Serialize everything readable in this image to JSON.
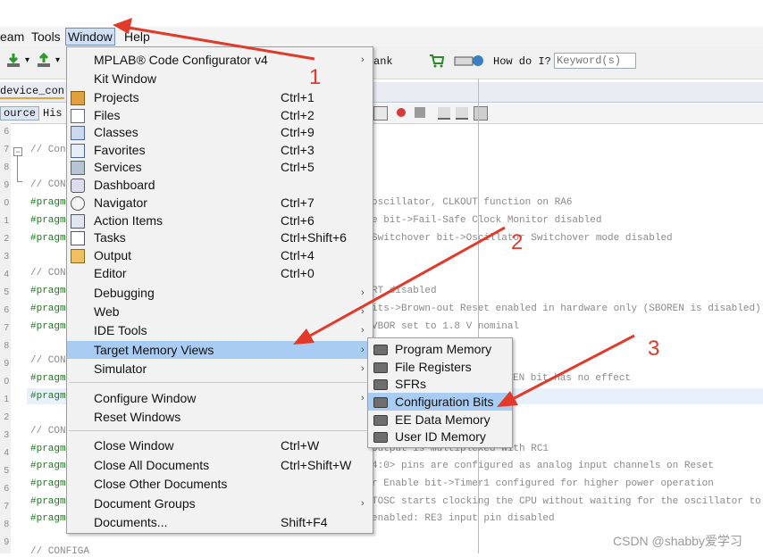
{
  "menubar": {
    "items": [
      "eam",
      "Tools",
      "Window",
      "Help"
    ]
  },
  "toolbar": {
    "bank_label": "ank",
    "howdoi_label": "How do I?",
    "keyword_placeholder": "Keyword(s)"
  },
  "editor": {
    "file_tab": "device_con",
    "source_tab": "ource",
    "history_tab": "His",
    "line_numbers": [
      "6",
      "7",
      "8",
      "9",
      "0",
      "1",
      "2",
      "3",
      "4",
      "5",
      "6",
      "7",
      "8",
      "9",
      "0",
      "1",
      "2",
      "3",
      "4",
      "5",
      "6",
      "7",
      "8",
      "9"
    ],
    "left_code": [
      {
        "text": "// Con",
        "kind": "cm"
      },
      {
        "text": "// CON",
        "kind": "cm"
      },
      {
        "text": "#pragm",
        "kind": "pr"
      },
      {
        "text": "#pragm",
        "kind": "pr"
      },
      {
        "text": "#pragm",
        "kind": "pr"
      },
      {
        "text": "// CON",
        "kind": "cm"
      },
      {
        "text": "#pragm",
        "kind": "pr"
      },
      {
        "text": "#pragm",
        "kind": "pr"
      },
      {
        "text": "#pragm",
        "kind": "pr"
      },
      {
        "text": "// CON",
        "kind": "cm"
      },
      {
        "text": "#pragm",
        "kind": "pr"
      },
      {
        "text": "#pragm",
        "kind": "pr"
      },
      {
        "text": "// CON",
        "kind": "cm"
      },
      {
        "text": "#pragm",
        "kind": "pr"
      },
      {
        "text": "#pragm",
        "kind": "pr"
      },
      {
        "text": "#pragm",
        "kind": "pr"
      },
      {
        "text": "#pragm",
        "kind": "pr"
      },
      {
        "text": "#pragm",
        "kind": "pr"
      },
      {
        "text": "// CONFIGA",
        "kind": "cm"
      }
    ],
    "right_code": [
      "oscillator, CLKOUT function on RA6",
      "e bit->Fail-Safe Clock Monitor disabled",
      "Switchover bit->Oscillator Switchover mode disabled",
      "RT disabled",
      "its->Brown-out Reset enabled in hardware only (SBOREN is disabled)",
      "VBOR set to 1.8 V nominal",
      "EN bit has no effect",
      "output is multiplexed with RC1",
      "4:0> pins are configured as analog input channels on Reset",
      "r Enable bit->Timer1 configured for higher power operation",
      "TOSC starts clocking the CPU without waiting for the oscillator to stab",
      "enabled: RE3 input pin disabled"
    ]
  },
  "window_menu": {
    "items": [
      {
        "label": "MPLAB® Code Configurator v4",
        "shortcut": "",
        "submenu": true,
        "icon": ""
      },
      {
        "label": "Kit Window",
        "shortcut": "",
        "submenu": false,
        "icon": ""
      },
      {
        "label": "Projects",
        "shortcut": "Ctrl+1",
        "submenu": false,
        "icon": "projects-icon"
      },
      {
        "label": "Files",
        "shortcut": "Ctrl+2",
        "submenu": false,
        "icon": "files-icon"
      },
      {
        "label": "Classes",
        "shortcut": "Ctrl+9",
        "submenu": false,
        "icon": "classes-icon"
      },
      {
        "label": "Favorites",
        "shortcut": "Ctrl+3",
        "submenu": false,
        "icon": "favorites-icon"
      },
      {
        "label": "Services",
        "shortcut": "Ctrl+5",
        "submenu": false,
        "icon": "services-icon"
      },
      {
        "label": "Dashboard",
        "shortcut": "",
        "submenu": false,
        "icon": "dashboard-icon"
      },
      {
        "label": "Navigator",
        "shortcut": "Ctrl+7",
        "submenu": false,
        "icon": "navigator-icon"
      },
      {
        "label": "Action Items",
        "shortcut": "Ctrl+6",
        "submenu": false,
        "icon": "action-items-icon"
      },
      {
        "label": "Tasks",
        "shortcut": "Ctrl+Shift+6",
        "submenu": false,
        "icon": "tasks-icon"
      },
      {
        "label": "Output",
        "shortcut": "Ctrl+4",
        "submenu": false,
        "icon": "output-icon"
      },
      {
        "label": "Editor",
        "shortcut": "Ctrl+0",
        "submenu": false,
        "icon": ""
      },
      {
        "label": "Debugging",
        "shortcut": "",
        "submenu": true,
        "icon": ""
      },
      {
        "label": "Web",
        "shortcut": "",
        "submenu": true,
        "icon": ""
      },
      {
        "label": "IDE Tools",
        "shortcut": "",
        "submenu": true,
        "icon": ""
      },
      {
        "label": "Target Memory Views",
        "shortcut": "",
        "submenu": true,
        "icon": "",
        "selected": true
      },
      {
        "label": "Simulator",
        "shortcut": "",
        "submenu": true,
        "icon": ""
      },
      {
        "label": "Configure Window",
        "shortcut": "",
        "submenu": true,
        "icon": ""
      },
      {
        "label": "Reset Windows",
        "shortcut": "",
        "submenu": false,
        "icon": ""
      },
      {
        "label": "Close Window",
        "shortcut": "Ctrl+W",
        "submenu": false,
        "icon": ""
      },
      {
        "label": "Close All Documents",
        "shortcut": "Ctrl+Shift+W",
        "submenu": false,
        "icon": ""
      },
      {
        "label": "Close Other Documents",
        "shortcut": "",
        "submenu": false,
        "icon": ""
      },
      {
        "label": "Document Groups",
        "shortcut": "",
        "submenu": true,
        "icon": ""
      },
      {
        "label": "Documents...",
        "shortcut": "Shift+F4",
        "submenu": false,
        "icon": ""
      }
    ]
  },
  "submenu": {
    "items": [
      {
        "label": "Program Memory",
        "selected": false
      },
      {
        "label": "File Registers",
        "selected": false
      },
      {
        "label": "SFRs",
        "selected": false
      },
      {
        "label": "Configuration Bits",
        "selected": true
      },
      {
        "label": "EE Data Memory",
        "selected": false
      },
      {
        "label": "User ID Memory",
        "selected": false
      }
    ]
  },
  "annotations": {
    "labels": [
      "1",
      "2",
      "3"
    ],
    "color": "#e23a2a"
  },
  "watermark": "CSDN @shabby爱学习",
  "colors": {
    "menu_bg": "#f2f2f2",
    "selection": "#a9cdf2",
    "pragma": "#1a7a1a",
    "comment": "#8a8a8a"
  }
}
